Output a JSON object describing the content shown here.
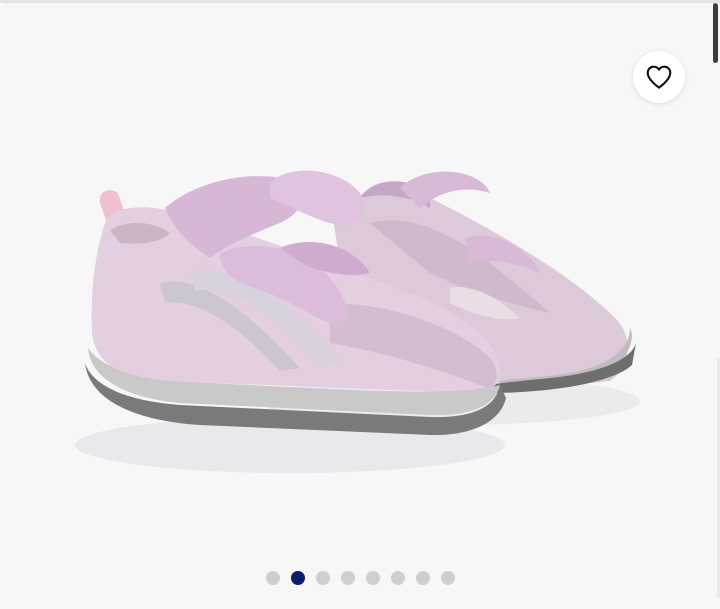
{
  "gallery": {
    "wishlist_button": {
      "icon": "heart-outline-icon"
    },
    "product_image": {
      "subject": "pink-sneakers-with-satin-ribbon-laces"
    },
    "carousel": {
      "count": 8,
      "active_index": 1,
      "active_color": "#0b1e6b",
      "inactive_color": "#cfcfd3"
    }
  }
}
